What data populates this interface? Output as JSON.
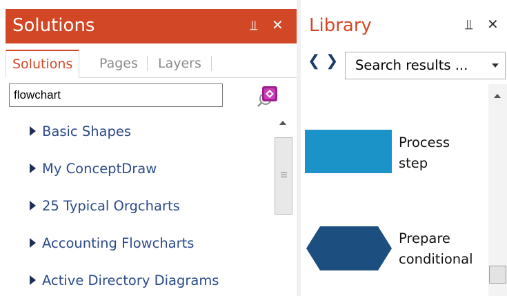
{
  "solutions": {
    "title": "Solutions",
    "pin_glyph": "⫫",
    "close_glyph": "✕",
    "tabs": [
      {
        "label": "Solutions",
        "active": true
      },
      {
        "label": "Pages",
        "active": false
      },
      {
        "label": "Layers",
        "active": false
      }
    ],
    "search": {
      "value": "flowchart",
      "placeholder": ""
    },
    "tree": [
      {
        "label": "Basic Shapes"
      },
      {
        "label": "My ConceptDraw"
      },
      {
        "label": "25 Typical Orgcharts"
      },
      {
        "label": "Accounting Flowcharts"
      },
      {
        "label": "Active Directory Diagrams"
      }
    ]
  },
  "library": {
    "title": "Library",
    "pin_glyph": "⫫",
    "close_glyph": "✕",
    "back_glyph": "❮",
    "forward_glyph": "❯",
    "selected": "Search results ...",
    "items": [
      {
        "label_line1": "Process",
        "label_line2": "step",
        "shape": "rectangle",
        "color": "#1b93c8"
      },
      {
        "label_line1": "Prepare",
        "label_line2": "conditional",
        "shape": "hexagon",
        "color": "#1c4f80"
      }
    ]
  },
  "colors": {
    "accent": "#d24726",
    "link": "#2a4a8a"
  }
}
